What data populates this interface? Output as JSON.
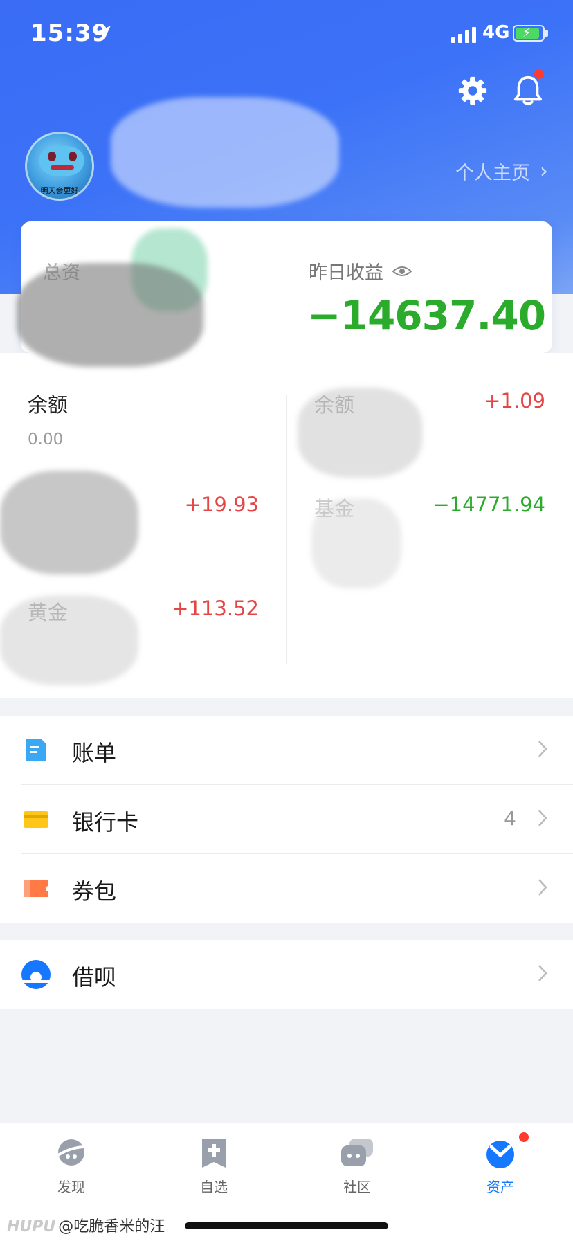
{
  "status_bar": {
    "time": "15:39",
    "network": "4G"
  },
  "header": {
    "avatar_caption": "明天会更好",
    "profile_link": "个人主页",
    "colors": {
      "gradient_start": "#3a6cf5",
      "gradient_end": "#7aa4f5"
    }
  },
  "summary": {
    "left_label": "总资",
    "right_label": "昨日收益",
    "right_value": "−14637.40",
    "icons": {
      "visibility": "eye-icon"
    }
  },
  "assets": {
    "left": [
      {
        "title": "余额",
        "sub": "0.00",
        "value": ""
      },
      {
        "title": "",
        "sub": "",
        "value": "+19.93"
      },
      {
        "title": "黄金",
        "sub": "",
        "value": "+113.52"
      }
    ],
    "right": [
      {
        "title": "余额",
        "sub": "",
        "value": "+1.09"
      },
      {
        "title": "基金",
        "sub": "",
        "value": "−14771.94"
      }
    ],
    "colors": {
      "positive": "#e64545",
      "negative": "#2bab2b"
    }
  },
  "menu": {
    "group1": [
      {
        "label": "账单",
        "count": "",
        "icon": "bill-icon"
      },
      {
        "label": "银行卡",
        "count": "4",
        "icon": "bank-card-icon"
      },
      {
        "label": "券包",
        "count": "",
        "icon": "coupon-icon"
      }
    ],
    "group2": [
      {
        "label": "借呗",
        "count": "",
        "icon": "jiebei-icon"
      }
    ]
  },
  "tabbar": {
    "tabs": [
      {
        "label": "发现",
        "icon": "discover-icon",
        "active": false
      },
      {
        "label": "自选",
        "icon": "watchlist-icon",
        "active": false
      },
      {
        "label": "社区",
        "icon": "community-icon",
        "active": false
      },
      {
        "label": "资产",
        "icon": "assets-icon",
        "active": true
      }
    ],
    "accent": "#1677ff"
  },
  "watermark": {
    "brand": "HUPU",
    "handle": "@吃脆香米的汪"
  }
}
